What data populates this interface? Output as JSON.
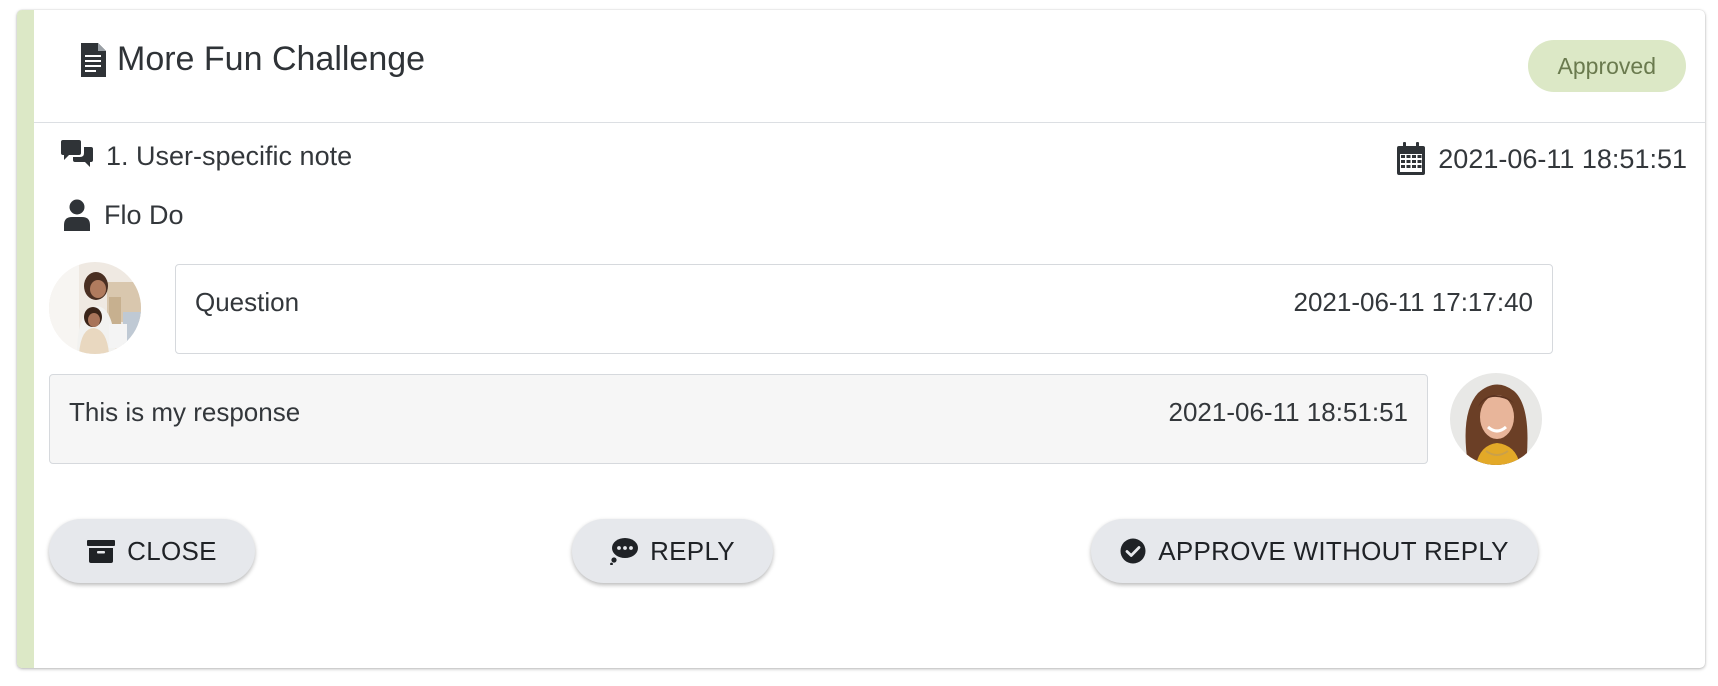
{
  "header": {
    "title": "More Fun Challenge",
    "title_icon": "document-icon",
    "status": "Approved"
  },
  "note": {
    "label": "1. User-specific note",
    "icon": "comments-icon",
    "date": "2021-06-11 18:51:51",
    "date_icon": "calendar-icon",
    "user": "Flo Do",
    "user_icon": "user-icon"
  },
  "question": {
    "text": "Question",
    "time": "2021-06-11 17:17:40"
  },
  "response": {
    "text": "This is my response",
    "time": "2021-06-11 18:51:51"
  },
  "actions": {
    "close_label": "CLOSE",
    "close_icon": "archive-icon",
    "reply_label": "REPLY",
    "reply_icon": "comment-dots-icon",
    "approve_label": "APPROVE WITHOUT REPLY",
    "approve_icon": "check-circle-icon"
  },
  "colors": {
    "accent": "#dce8c6",
    "badge_text": "#6a7a4e",
    "button_bg": "#e6e8ec",
    "response_bg": "#f6f6f6"
  }
}
